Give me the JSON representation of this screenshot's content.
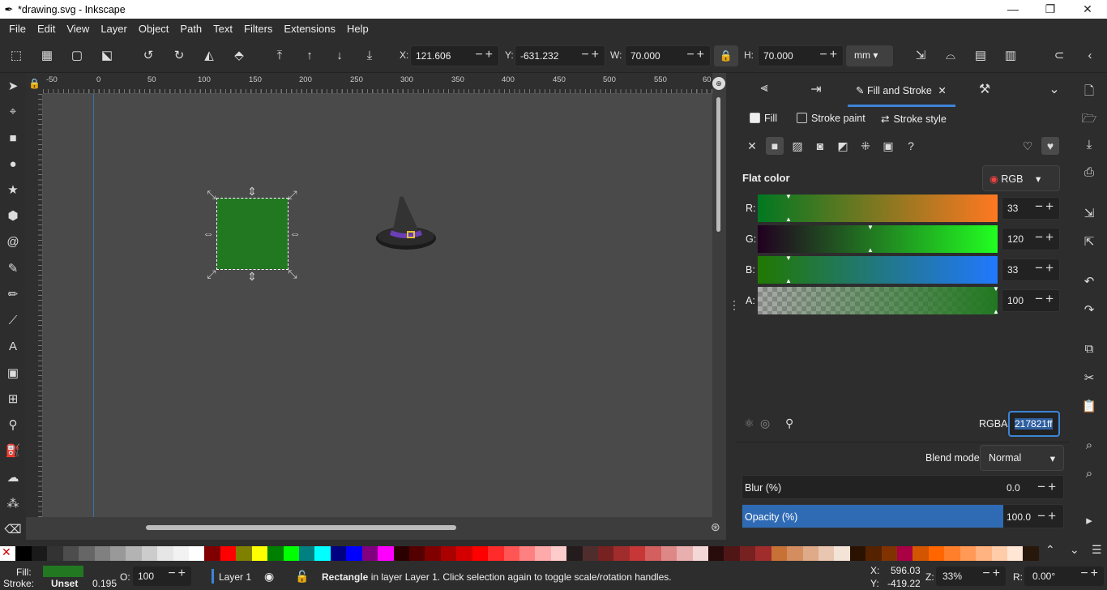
{
  "window": {
    "title": "*drawing.svg - Inkscape",
    "minimize": "—",
    "maximize": "❐",
    "close": "✕",
    "app_icon": "inkscape-logo"
  },
  "menu": [
    "File",
    "Edit",
    "View",
    "Layer",
    "Object",
    "Path",
    "Text",
    "Filters",
    "Extensions",
    "Help"
  ],
  "toolbar": {
    "x_label": "X:",
    "x_value": "121.606",
    "y_label": "Y:",
    "y_value": "-631.232",
    "w_label": "W:",
    "w_value": "70.000",
    "h_label": "H:",
    "h_value": "70.000",
    "unit": "mm"
  },
  "ruler": {
    "ticks": [
      "-50",
      "0",
      "50",
      "100",
      "150",
      "200",
      "250",
      "300",
      "350",
      "400",
      "450",
      "500",
      "550",
      "60"
    ]
  },
  "dialog": {
    "tab_label": "Fill and Stroke",
    "subtabs": {
      "fill": "Fill",
      "stroke_paint": "Stroke paint",
      "stroke_style": "Stroke style"
    },
    "flat_color": "Flat color",
    "color_mode": "RGB",
    "channels": [
      {
        "label": "R:",
        "value": "33"
      },
      {
        "label": "G:",
        "value": "120"
      },
      {
        "label": "B:",
        "value": "33"
      },
      {
        "label": "A:",
        "value": "100"
      }
    ],
    "rgba_label": "RGBA:",
    "rgba_value": "217821ff",
    "blend_label": "Blend mode:",
    "blend_value": "Normal",
    "blur_label": "Blur (%)",
    "blur_value": "0.0",
    "opacity_label": "Opacity (%)",
    "opacity_value": "100.0"
  },
  "colors": {
    "selection_fill": "#217821",
    "accent": "#3d84d6"
  },
  "status": {
    "fill_label": "Fill:",
    "stroke_label": "Stroke:",
    "stroke_value": "Unset",
    "stroke_width": "0.195",
    "opacity_label": "O:",
    "opacity_value": "100",
    "layer": "Layer 1",
    "message_bold": "Rectangle",
    "message": " in layer Layer 1. Click selection again to toggle scale/rotation handles.",
    "cursor_x_label": "X:",
    "cursor_x": "596.03",
    "cursor_y_label": "Y:",
    "cursor_y": "-419.22",
    "zoom_label": "Z:",
    "zoom": "33%",
    "rotation_label": "R:",
    "rotation": "0.00°"
  }
}
